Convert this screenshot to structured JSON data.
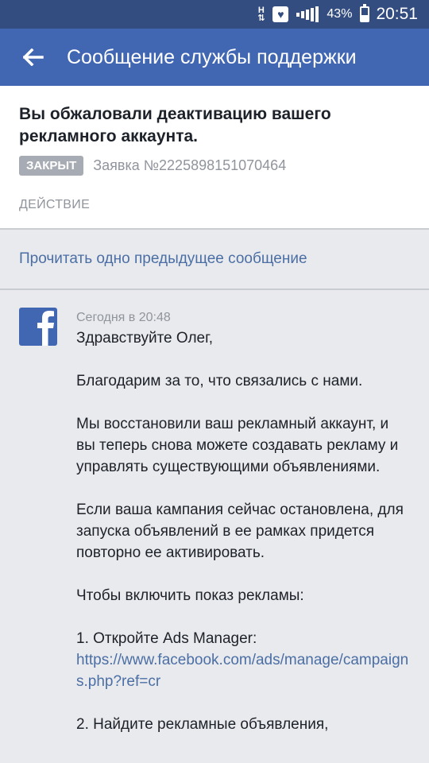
{
  "status_bar": {
    "h_indicator": "H",
    "battery_percent": "43%",
    "battery_level": 0.43,
    "time": "20:51"
  },
  "app_bar": {
    "back_icon": "arrow-left-icon",
    "title": "Сообщение службы поддержки"
  },
  "ticket": {
    "headline": "Вы обжаловали деактивацию вашего рекламного аккаунта.",
    "status_badge": "ЗАКРЫТ",
    "ticket_number": "Заявка №2225898151070464",
    "action_label": "ДЕЙСТВИЕ"
  },
  "previous": {
    "link_text": "Прочитать одно предыдущее сообщение"
  },
  "message": {
    "sender_icon": "facebook-icon",
    "timestamp": "Сегодня в 20:48",
    "greeting": "Здравствуйте Олег,",
    "p1": "Благодарим за то, что связались с нами.",
    "p2": "Мы восстановили ваш рекламный аккаунт, и вы теперь снова можете создавать рекламу и управлять существующими объявлениями.",
    "p3": "Если ваша кампания сейчас остановлена, для запуска объявлений в ее рамках придется повторно ее активировать.",
    "p4": "Чтобы включить показ рекламы:",
    "step1_text": "1. Откройте Ads Manager:",
    "step1_link": "https://www.facebook.com/ads/manage/campaigns.php?ref=cr",
    "step2_text": "2. Найдите рекламные объявления,"
  },
  "colors": {
    "status_bar": "#344d80",
    "app_bar": "#4267b2",
    "link": "#4b6fa5",
    "badge": "#a7abb3",
    "background": "#e9eaed"
  }
}
